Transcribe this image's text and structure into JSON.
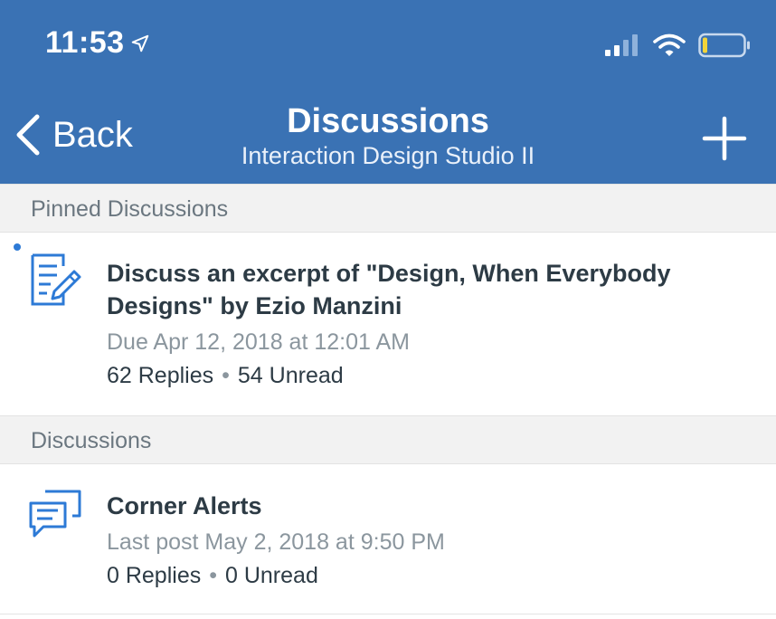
{
  "status_bar": {
    "time": "11:53"
  },
  "nav": {
    "back_label": "Back",
    "title": "Discussions",
    "subtitle": "Interaction Design Studio II"
  },
  "colors": {
    "nav_background": "#3a72b4",
    "accent_blue": "#2d7ad6",
    "battery_level": "#f2d43a"
  },
  "sections": {
    "pinned_header": "Pinned Discussions",
    "discussions_header": "Discussions"
  },
  "pinned": [
    {
      "icon": "assignment-discussion-icon",
      "title": "Discuss an excerpt of \"Design, When Everybody Designs\" by Ezio Manzini",
      "meta": "Due Apr 12, 2018 at 12:01 AM",
      "replies": "62 Replies",
      "unread": "54 Unread",
      "is_unread": true
    }
  ],
  "discussions": [
    {
      "icon": "discussion-bubbles-icon",
      "title": "Corner Alerts",
      "meta": "Last post May 2, 2018 at 9:50 PM",
      "replies": "0 Replies",
      "unread": "0 Unread"
    }
  ],
  "separator": "•"
}
